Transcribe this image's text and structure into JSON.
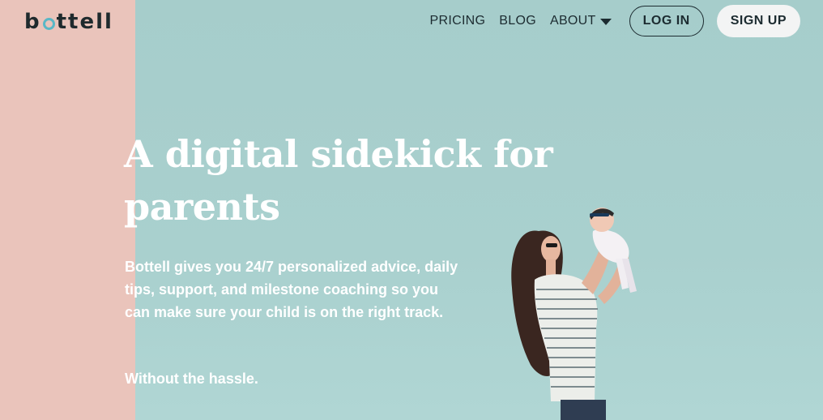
{
  "brand": {
    "logo_prefix": "b",
    "logo_suffix": "ttell"
  },
  "nav": {
    "items": [
      {
        "label": "PRICING"
      },
      {
        "label": "BLOG"
      },
      {
        "label": "ABOUT"
      }
    ],
    "login_label": "LOG IN",
    "signup_label": "SIGN UP"
  },
  "hero": {
    "headline": "A digital sidekick for parents",
    "description": "Bottell gives you 24/7 personalized advice, daily tips, support, and milestone coaching so you can make sure your child is on the right track.",
    "tagline": "Without the hassle."
  },
  "colors": {
    "accent_pink": "#eac4bb",
    "background_teal": "#a8cfcd",
    "logo_ring": "#5ab7c6"
  },
  "icons": {
    "about_dropdown": "caret-down-icon"
  }
}
